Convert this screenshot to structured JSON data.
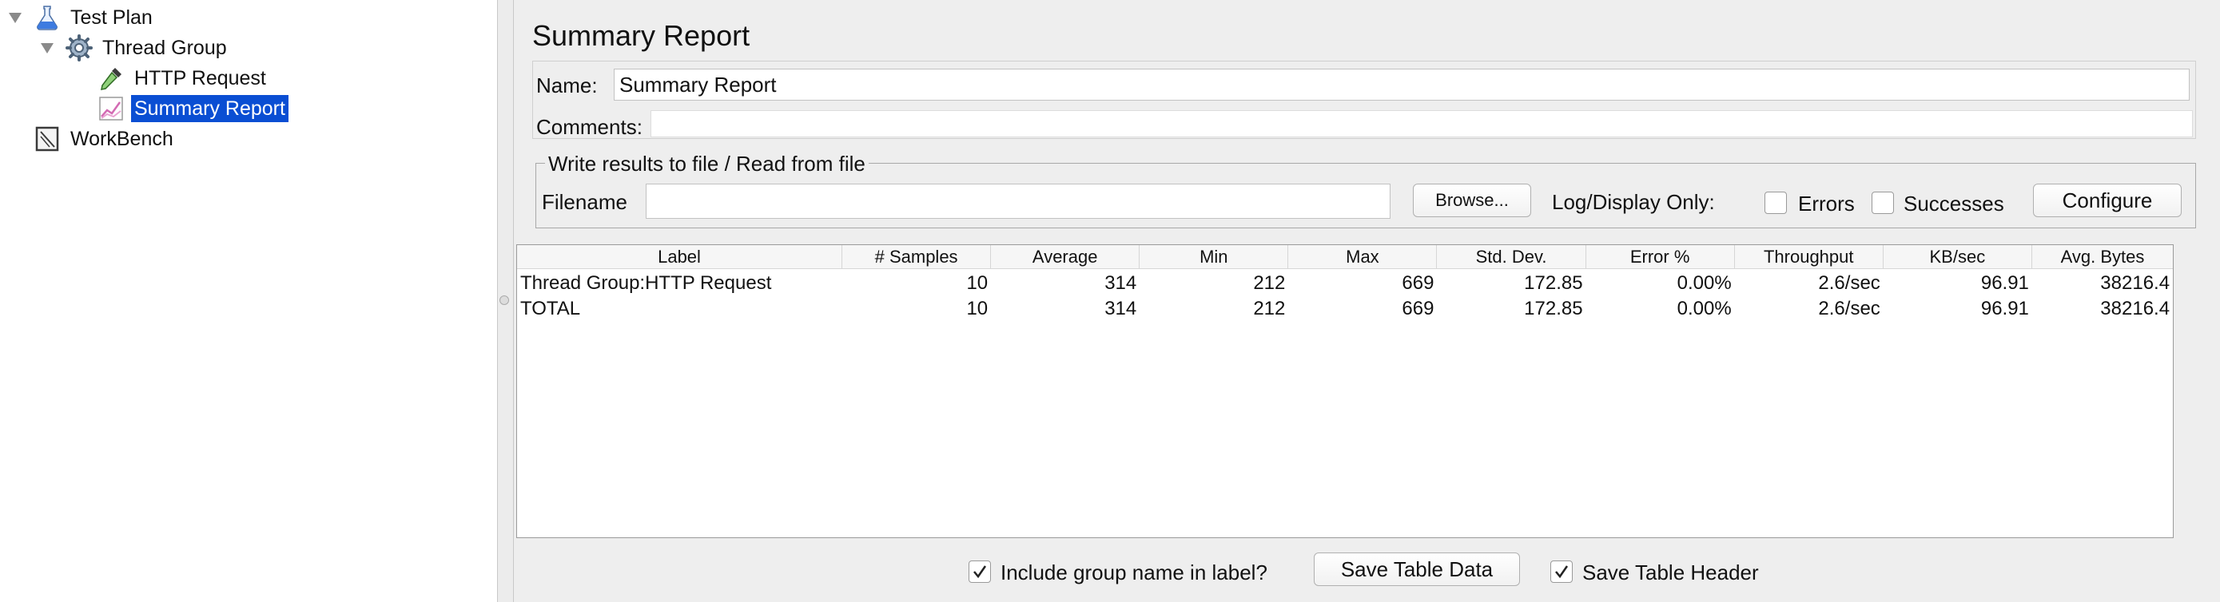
{
  "tree": {
    "items": [
      {
        "label": "Test Plan",
        "icon": "test-plan-flask-icon",
        "expanded": true
      },
      {
        "label": "Thread Group",
        "icon": "thread-group-gear-icon",
        "expanded": true
      },
      {
        "label": "HTTP Request",
        "icon": "http-request-pipette-icon"
      },
      {
        "label": "Summary Report",
        "icon": "summary-report-graph-icon",
        "selected": true
      },
      {
        "label": "WorkBench",
        "icon": "workbench-icon"
      }
    ]
  },
  "panel": {
    "title": "Summary Report",
    "name_label": "Name:",
    "name_value": "Summary Report",
    "comments_label": "Comments:",
    "comments_value": "",
    "file_group_title": "Write results to file / Read from file",
    "filename_label": "Filename",
    "filename_value": "",
    "browse_label": "Browse...",
    "log_display_label": "Log/Display Only:",
    "errors_label": "Errors",
    "errors_checked": false,
    "successes_label": "Successes",
    "successes_checked": false,
    "configure_label": "Configure"
  },
  "table": {
    "columns": [
      "Label",
      "# Samples",
      "Average",
      "Min",
      "Max",
      "Std. Dev.",
      "Error %",
      "Throughput",
      "KB/sec",
      "Avg. Bytes"
    ],
    "rows": [
      [
        "Thread Group:HTTP Request",
        "10",
        "314",
        "212",
        "669",
        "172.85",
        "0.00%",
        "2.6/sec",
        "96.91",
        "38216.4"
      ],
      [
        "TOTAL",
        "10",
        "314",
        "212",
        "669",
        "172.85",
        "0.00%",
        "2.6/sec",
        "96.91",
        "38216.4"
      ]
    ]
  },
  "bottom": {
    "include_group_label": "Include group name in label?",
    "include_group_checked": true,
    "save_table_data_label": "Save Table Data",
    "save_table_header_label": "Save Table Header",
    "save_table_header_checked": true
  },
  "colors": {
    "selection": "#0a4ed3",
    "panel_bg": "#eeeeee"
  }
}
